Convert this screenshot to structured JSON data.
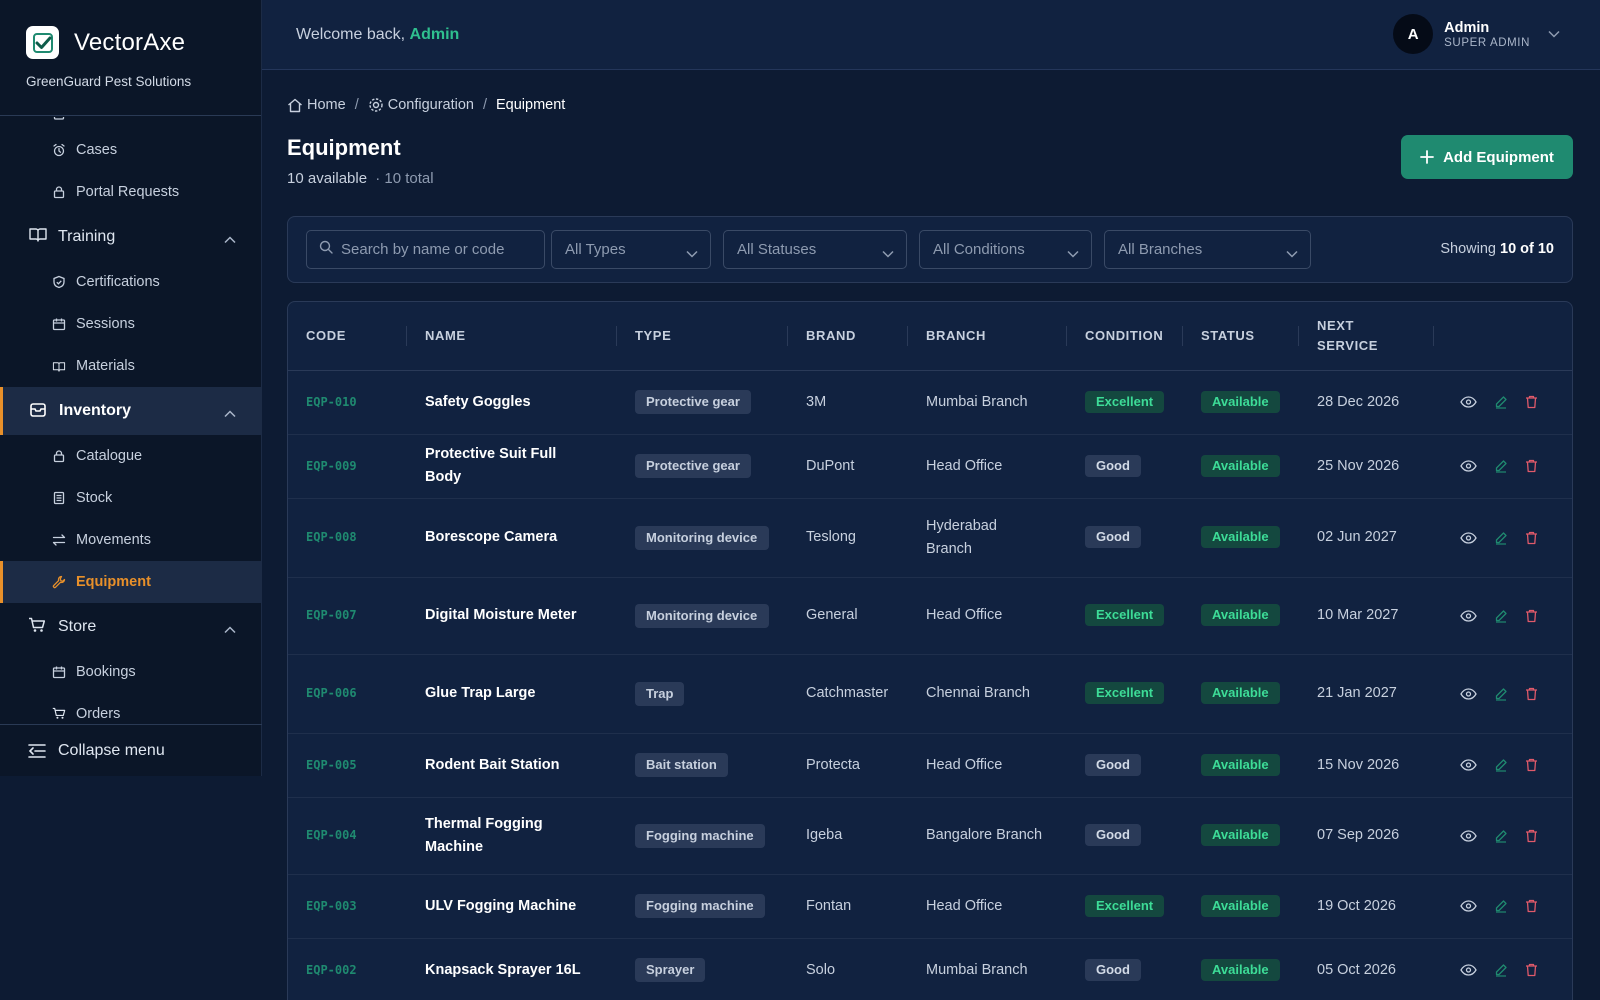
{
  "brand": {
    "name": "VectorAxe",
    "org": "GreenGuard Pest Solutions"
  },
  "header": {
    "welcome": "Welcome back,",
    "welcome_user": "Admin",
    "user_name": "Admin",
    "user_role": "SUPER ADMIN",
    "avatar_initial": "A"
  },
  "sidebar": {
    "items": [
      {
        "kind": "sub",
        "label": "Cases",
        "icon": "alarm-icon"
      },
      {
        "kind": "sub",
        "label": "Portal Requests",
        "icon": "lock-icon"
      },
      {
        "kind": "section",
        "label": "Training",
        "icon": "book-icon",
        "expanded": true
      },
      {
        "kind": "sub",
        "label": "Certifications",
        "icon": "shield-icon"
      },
      {
        "kind": "sub",
        "label": "Sessions",
        "icon": "calendar-icon"
      },
      {
        "kind": "sub",
        "label": "Materials",
        "icon": "book-icon"
      },
      {
        "kind": "section",
        "label": "Inventory",
        "icon": "box-icon",
        "expanded": true,
        "active": true
      },
      {
        "kind": "sub",
        "label": "Catalogue",
        "icon": "lock-icon"
      },
      {
        "kind": "sub",
        "label": "Stock",
        "icon": "list-icon"
      },
      {
        "kind": "sub",
        "label": "Movements",
        "icon": "transfer-icon"
      },
      {
        "kind": "sub",
        "label": "Equipment",
        "icon": "wrench-icon",
        "active": true
      },
      {
        "kind": "section",
        "label": "Store",
        "icon": "cart-icon",
        "expanded": true
      },
      {
        "kind": "sub",
        "label": "Bookings",
        "icon": "calendar-icon"
      },
      {
        "kind": "sub",
        "label": "Orders",
        "icon": "cart-icon"
      }
    ],
    "collapse_label": "Collapse menu"
  },
  "breadcrumb": {
    "home": "Home",
    "section": "Configuration",
    "current": "Equipment",
    "separator": "/"
  },
  "page": {
    "title": "Equipment",
    "available": "10 available",
    "total": "· 10 total",
    "add_label": "Add Equipment"
  },
  "filters": {
    "search_placeholder": "Search by name or code",
    "types": "All Types",
    "statuses": "All Statuses",
    "conditions": "All Conditions",
    "branches": "All Branches",
    "showing_prefix": "Showing",
    "showing_count": "10 of 10"
  },
  "table": {
    "columns": [
      "CODE",
      "NAME",
      "TYPE",
      "BRAND",
      "BRANCH",
      "CONDITION",
      "STATUS",
      "NEXT SERVICE"
    ],
    "rows": [
      {
        "code": "EQP-010",
        "name": "Safety Goggles",
        "type": "Protective gear",
        "brand": "3M",
        "branch": "Mumbai Branch",
        "condition": "Excellent",
        "status": "Available",
        "next": "28 Dec 2026"
      },
      {
        "code": "EQP-009",
        "name": "Protective Suit Full Body",
        "type": "Protective gear",
        "brand": "DuPont",
        "branch": "Head Office",
        "condition": "Good",
        "status": "Available",
        "next": "25 Nov 2026"
      },
      {
        "code": "EQP-008",
        "name": "Borescope Camera",
        "type": "Monitoring device",
        "brand": "Teslong",
        "branch": "Hyderabad Branch",
        "condition": "Good",
        "status": "Available",
        "next": "02 Jun 2027"
      },
      {
        "code": "EQP-007",
        "name": "Digital Moisture Meter",
        "type": "Monitoring device",
        "brand": "General",
        "branch": "Head Office",
        "condition": "Excellent",
        "status": "Available",
        "next": "10 Mar 2027"
      },
      {
        "code": "EQP-006",
        "name": "Glue Trap Large",
        "type": "Trap",
        "brand": "Catchmaster",
        "branch": "Chennai Branch",
        "condition": "Excellent",
        "status": "Available",
        "next": "21 Jan 2027"
      },
      {
        "code": "EQP-005",
        "name": "Rodent Bait Station",
        "type": "Bait station",
        "brand": "Protecta",
        "branch": "Head Office",
        "condition": "Good",
        "status": "Available",
        "next": "15 Nov 2026"
      },
      {
        "code": "EQP-004",
        "name": "Thermal Fogging Machine",
        "type": "Fogging machine",
        "brand": "Igeba",
        "branch": "Bangalore Branch",
        "condition": "Good",
        "status": "Available",
        "next": "07 Sep 2026"
      },
      {
        "code": "EQP-003",
        "name": "ULV Fogging Machine",
        "type": "Fogging machine",
        "brand": "Fontan",
        "branch": "Head Office",
        "condition": "Excellent",
        "status": "Available",
        "next": "19 Oct 2026"
      },
      {
        "code": "EQP-002",
        "name": "Knapsack Sprayer 16L",
        "type": "Sprayer",
        "brand": "Solo",
        "branch": "Mumbai Branch",
        "condition": "Good",
        "status": "Available",
        "next": "05 Oct 2026"
      }
    ]
  },
  "colors": {
    "accent": "#1f8a70",
    "active_nav": "#e8902a",
    "excellent": "#3ddc97",
    "delete": "#e05a6a"
  }
}
